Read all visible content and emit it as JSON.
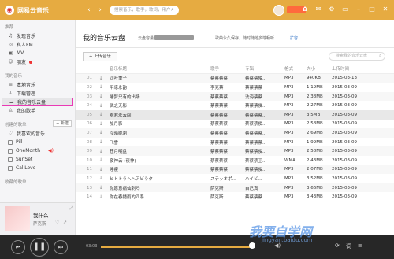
{
  "colors": {
    "brand": "#e6ab41",
    "selection_outline": "#e93ab5"
  },
  "app": {
    "title": "网易云音乐",
    "search_placeholder": "搜索音乐，歌手，歌词，用户"
  },
  "sidebar": {
    "sections": [
      {
        "label": "推荐",
        "items": [
          {
            "label": "发现音乐",
            "icon": "music-note-icon"
          },
          {
            "label": "私人FM",
            "icon": "radio-icon"
          },
          {
            "label": "MV",
            "icon": "mv-icon"
          },
          {
            "label": "朋友",
            "icon": "friends-icon"
          }
        ]
      },
      {
        "label": "我的音乐",
        "items": [
          {
            "label": "本地音乐",
            "icon": "list-icon"
          },
          {
            "label": "下载管理",
            "icon": "download-icon"
          },
          {
            "label": "我的音乐云盘",
            "icon": "cloud-icon",
            "active": true
          },
          {
            "label": "我的歌手",
            "icon": "singer-icon"
          }
        ]
      },
      {
        "label": "创建的歌单",
        "new_label": "+ 新建",
        "items": [
          {
            "label": "我喜欢的音乐",
            "icon": "heart-icon"
          },
          {
            "label": "Pill",
            "icon": "playlist-icon"
          },
          {
            "label": "OneMonth",
            "icon": "playlist-icon"
          },
          {
            "label": "SunSet",
            "icon": "playlist-icon"
          },
          {
            "label": "CaliLove",
            "icon": "playlist-icon"
          }
        ]
      },
      {
        "label": "收藏的歌单",
        "items": []
      }
    ]
  },
  "now_playing": {
    "title": "我什么",
    "artist": "萨克斯"
  },
  "main": {
    "title": "我的音乐云盘",
    "quota_label": "云盘容量",
    "tip": "歌曲永久保存，随时随地多端畅听",
    "expand_label": "扩容",
    "upload_label": "+ 上传音乐",
    "search_placeholder": "搜索我的音乐云盘",
    "columns": [
      "",
      "",
      "音乐标题",
      "歌手",
      "专辑",
      "格式",
      "大小",
      "上传时间"
    ],
    "rows": [
      [
        "01",
        "四叶重子",
        "蔡蔡蔡蔡",
        "蔡蔡蔡俊...",
        "MP3",
        "940KB",
        "2015-03-13"
      ],
      [
        "02",
        "平凉永韵",
        "李克蔡",
        "蔡蔡蔡蔡",
        "MP3",
        "1.19MB",
        "2015-03-09"
      ],
      [
        "03",
        "睡梦只有的出场",
        "蔡蔡蔡蔡",
        "洗海蔡蔡",
        "MP3",
        "2.38MB",
        "2015-03-09"
      ],
      [
        "04",
        "武之无影",
        "蔡蔡蔡蔡",
        "蔡蔡蔡俊...",
        "MP3",
        "2.27MB",
        "2015-03-09"
      ],
      [
        "05",
        "寿君永云间",
        "蔡蔡蔡蔡",
        "蔡蔡蔡蔡...",
        "MP3",
        "3.5MB",
        "2015-03-09"
      ],
      [
        "06",
        "加月影",
        "蔡蔡蔡蔡",
        "蔡蔡蔡俊...",
        "MP3",
        "2.58MB",
        "2015-03-09"
      ],
      [
        "07",
        "冷暗绝刺",
        "蔡蔡蔡蔡",
        "蔡蔡蔡蔡...",
        "MP3",
        "2.69MB",
        "2015-03-09"
      ],
      [
        "08",
        "飞雪",
        "蔡蔡蔡蔡",
        "蔡蔡蔡蔡...",
        "MP3",
        "1.99MB",
        "2015-03-09"
      ],
      [
        "09",
        "苍月明盘",
        "蔡蔡蔡蔡",
        "蔡蔡蔡俊...",
        "MP3",
        "2.58MB",
        "2015-03-09"
      ],
      [
        "10",
        "夜神云 (夜神)",
        "蔡蔡蔡蔡",
        "蔡蔡蔡卫...",
        "WMA",
        "2.43MB",
        "2015-03-09"
      ],
      [
        "11",
        "睡瘦",
        "蔡蔡蔡蔡",
        "蔡蔡蔡俊...",
        "MP3",
        "2.07MB",
        "2015-03-09"
      ],
      [
        "12",
        "ヒトトうへヘアビうタ",
        "ステッオポ...",
        "ハイビ...",
        "MP3",
        "3.52MB",
        "2015-03-09"
      ],
      [
        "13",
        "你愿意痛仙刺吗",
        "萨克斯",
        "自己真",
        "MP3",
        "3.66MB",
        "2015-03-09"
      ],
      [
        "14",
        "你在春播雨的四系",
        "萨克斯",
        "蔡蔡蔡蔡",
        "MP3",
        "3.43MB",
        "2015-03-09"
      ]
    ]
  },
  "player": {
    "elapsed": "03:03",
    "progress": 0.98
  },
  "watermark": {
    "text": "我要自学网",
    "sub": "jingyan.baidu.com"
  }
}
